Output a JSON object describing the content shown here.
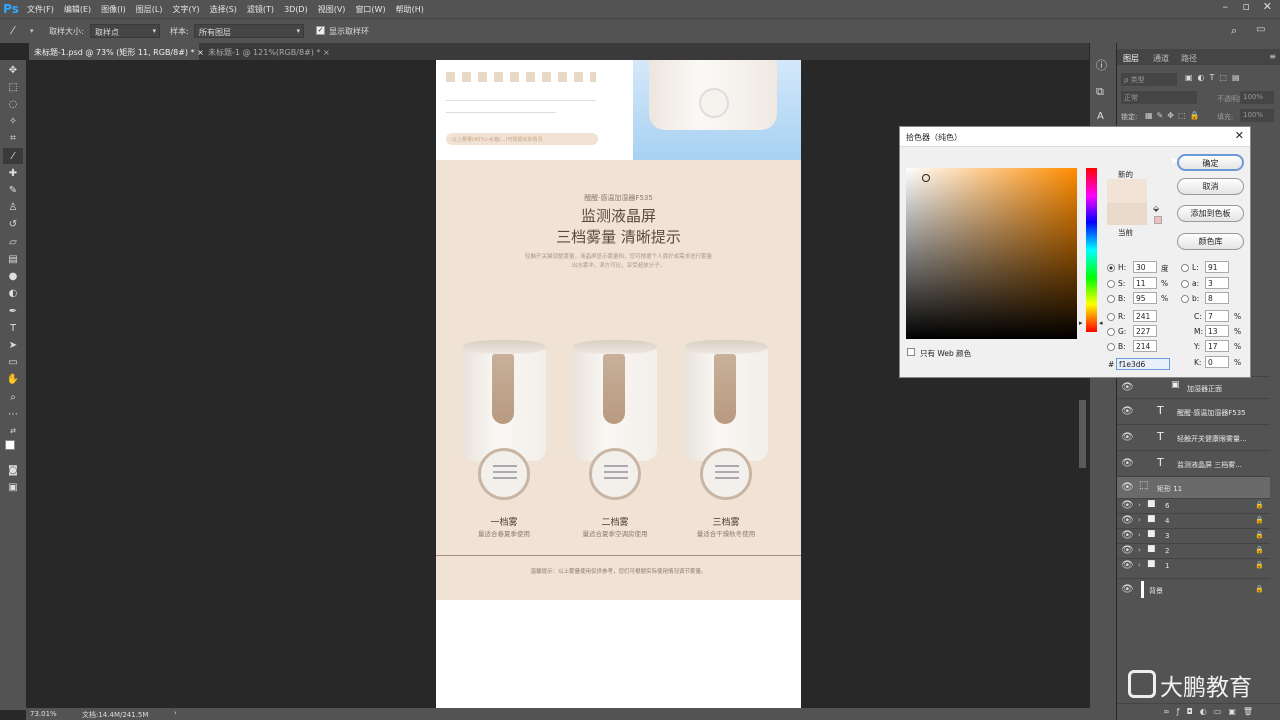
{
  "app": {
    "logo": "Ps"
  },
  "menu": [
    "文件(F)",
    "编辑(E)",
    "图像(I)",
    "图层(L)",
    "文字(Y)",
    "选择(S)",
    "滤镜(T)",
    "3D(D)",
    "视图(V)",
    "窗口(W)",
    "帮助(H)"
  ],
  "options": {
    "sample_size_label": "取样大小:",
    "sample_size_value": "取样点",
    "sample_label": "样本:",
    "sample_value": "所有图层",
    "show_ring_label": "显示取样环"
  },
  "tabs": [
    {
      "label": "未标题-1.psd @ 73% (矩形 11, RGB/8#) *",
      "active": true
    },
    {
      "label": "未标题-1 @ 121%(RGB/8#) *",
      "active": false
    }
  ],
  "status": {
    "zoom": "73.01%",
    "doc": "文档:14.4M/241.5M"
  },
  "layers_panel": {
    "tabs": [
      "图层",
      "通道",
      "路径"
    ],
    "filter_placeholder": "ρ 类型",
    "blend_mode": "正常",
    "opacity_label": "不透明度:",
    "opacity_value": "100%",
    "lock_label": "锁定:",
    "fill_label": "填充:",
    "fill_value": "100%",
    "layers": [
      {
        "name": "加湿器正面",
        "type": "smart"
      },
      {
        "name": "醒醒·感温加湿器F535",
        "type": "text"
      },
      {
        "name": "轻触开关健康眼雾量...",
        "type": "text"
      },
      {
        "name": "监测液晶屏 三档雾...",
        "type": "text"
      },
      {
        "name": "矩形 11",
        "type": "shape",
        "selected": true
      },
      {
        "name": "6",
        "type": "group"
      },
      {
        "name": "4",
        "type": "group"
      },
      {
        "name": "3",
        "type": "group"
      },
      {
        "name": "2",
        "type": "group"
      },
      {
        "name": "1",
        "type": "group"
      },
      {
        "name": "背景",
        "type": "background"
      }
    ]
  },
  "picker": {
    "title": "拾色器（纯色）",
    "ok": "确定",
    "cancel": "取消",
    "add_swatch": "添加到色板",
    "libraries": "颜色库",
    "new_label": "新的",
    "current_label": "当前",
    "new_color": "#f1e3d6",
    "current_color": "#f1e3d6",
    "web_only": "只有 Web 颜色",
    "fields": {
      "H": "30",
      "H_unit": "度",
      "S": "11",
      "S_unit": "%",
      "B": "95",
      "B_unit": "%",
      "R": "241",
      "G": "227",
      "B2": "214",
      "L": "91",
      "a": "3",
      "b": "8",
      "C": "7",
      "M": "13",
      "Y": "17",
      "K": "0",
      "pct": "%"
    },
    "hex_label": "#",
    "hex": "f1e3d6"
  },
  "doc": {
    "top_banner": "以上雾量(40%)-水箱(...)可根据实际情况",
    "brand": "醒醒·感温加湿器F535",
    "headline1": "监测液晶屏",
    "headline2": "三档雾量 清晰提示",
    "desc1": "轻触开关键调整雾量，液晶屏显示雾量档，您可根据个人喜好或需求进行雾量",
    "desc2": "出水雾冲，滴方可比，享受超放分子。",
    "modes": [
      {
        "title": "一档雾",
        "desc": "量适合春夏季使用"
      },
      {
        "title": "二档雾",
        "desc": "量适合夏季空调房使用"
      },
      {
        "title": "三档雾",
        "desc": "量适合干燥秋冬使用"
      }
    ],
    "tip": "温馨提示：以上雾量使用仅供参考，您们可根据实际使用情况调节雾量。"
  },
  "watermark": "大鹏教育",
  "colors": {
    "accent": "#31a8ff",
    "doc_bg": "#f0e2d5",
    "brown": "#c8ab91"
  }
}
